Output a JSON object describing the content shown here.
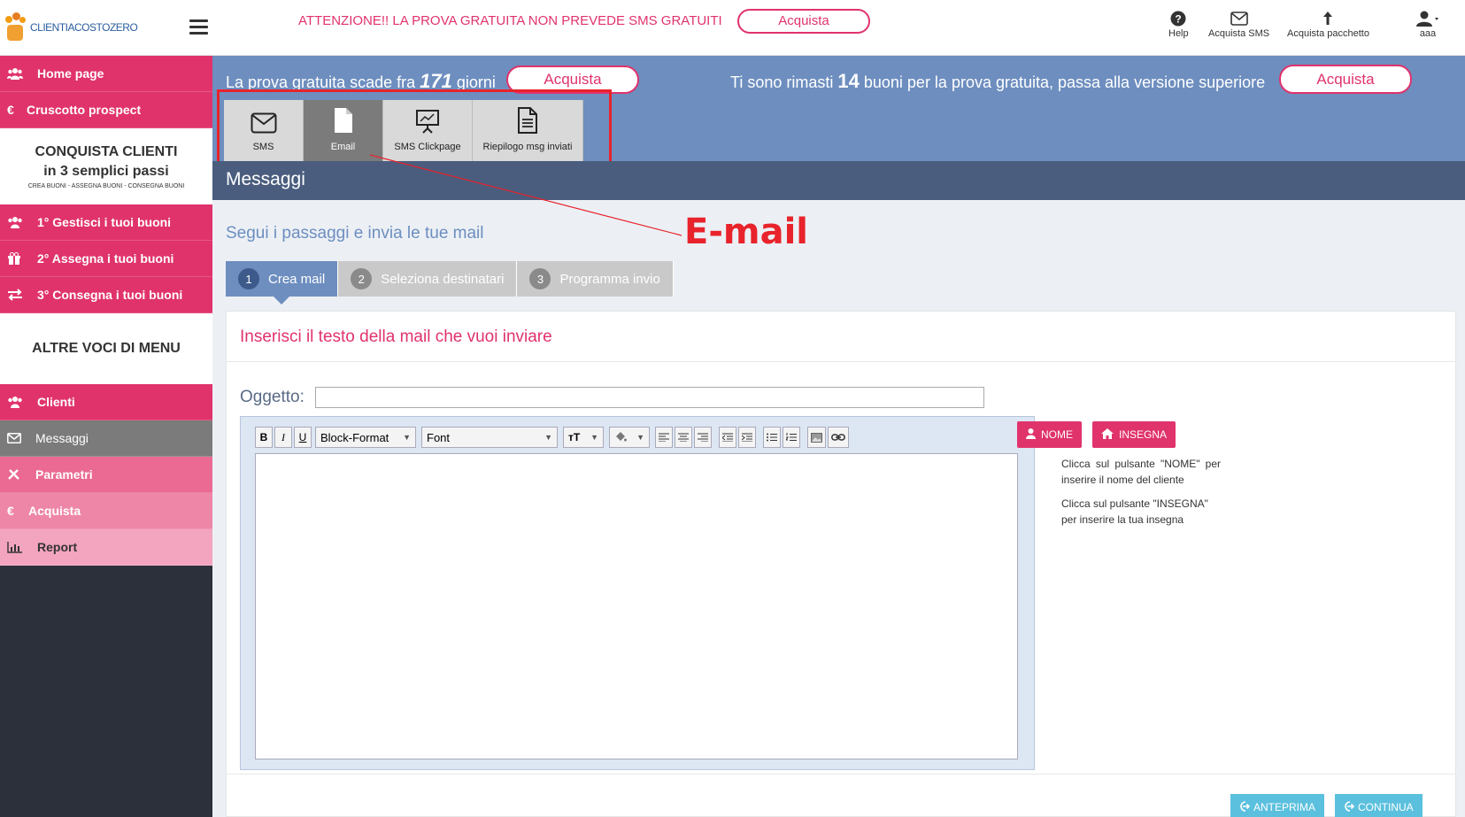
{
  "brand": {
    "logo_text": "CLIENTIACOSTOZERO"
  },
  "header": {
    "warning": "ATTENZIONE!! LA PROVA GRATUITA NON PREVEDE SMS GRATUITI",
    "buy_label": "Acquista",
    "icons": [
      {
        "icon": "question-circle-icon",
        "label": "Help"
      },
      {
        "icon": "envelope-icon",
        "label": "Acquista SMS"
      },
      {
        "icon": "arrow-up-icon",
        "label": "Acquista pacchetto"
      },
      {
        "icon": "user-icon",
        "label": "aaa"
      }
    ]
  },
  "sidebar": {
    "home": "Home page",
    "cruscotto": "Cruscotto prospect",
    "promo": {
      "title_line1": "CONQUISTA CLIENTI",
      "title_line2": "in 3 semplici passi",
      "subtitle": "CREA BUONI - ASSEGNA BUONI - CONSEGNA BUONI"
    },
    "steps": [
      "1°  Gestisci i tuoi buoni",
      "2°  Assegna i tuoi buoni",
      "3°  Consegna i tuoi buoni"
    ],
    "other_heading": "ALTRE VOCI DI MENU",
    "menu": [
      "Clienti",
      "Messaggi",
      "Parametri",
      "Acquista",
      "Report"
    ],
    "euro_symbol": "€"
  },
  "trial": {
    "prefix": "La prova gratuita scade fra",
    "days": "171",
    "suffix": "giorni",
    "buy_label": "Acquista",
    "buoni_prefix": "Ti sono rimasti",
    "buoni_count": "14",
    "buoni_suffix": "buoni per la prova gratuita, passa alla versione superiore",
    "buy_label2": "Acquista"
  },
  "tabs": [
    {
      "label": "SMS",
      "icon": "envelope-icon"
    },
    {
      "label": "Email",
      "icon": "document-icon"
    },
    {
      "label": "SMS Clickpage",
      "icon": "presentation-icon"
    },
    {
      "label": "Riepilogo msg inviati",
      "icon": "file-text-icon"
    }
  ],
  "page_title": "Messaggi",
  "annotation": "E-mail",
  "steps_heading": "Segui i passaggi e invia le tue mail",
  "wizard": [
    {
      "num": "1",
      "label": "Crea mail"
    },
    {
      "num": "2",
      "label": "Seleziona destinatari"
    },
    {
      "num": "3",
      "label": "Programma invio"
    }
  ],
  "panel": {
    "title": "Inserisci il testo della mail che vuoi inviare",
    "subject_label": "Oggetto:",
    "subject_value": "",
    "toolbar": {
      "bold": "B",
      "italic": "I",
      "underline": "U",
      "block_format": "Block-Format",
      "font": "Font"
    },
    "nome_button": "NOME",
    "insegna_button": "INSEGNA",
    "help_nome": "Clicca sul pulsante \"NOME\" per inserire il nome del cliente",
    "help_insegna": "Clicca sul pulsante \"INSEGNA\" per inserire la tua insegna",
    "preview_button": "ANTEPRIMA",
    "continue_button": "CONTINUA"
  },
  "colors": {
    "pink": "#e0336c",
    "blue": "#6d8ebf",
    "dark": "#2b303b",
    "annotation_red": "#e8232b"
  }
}
